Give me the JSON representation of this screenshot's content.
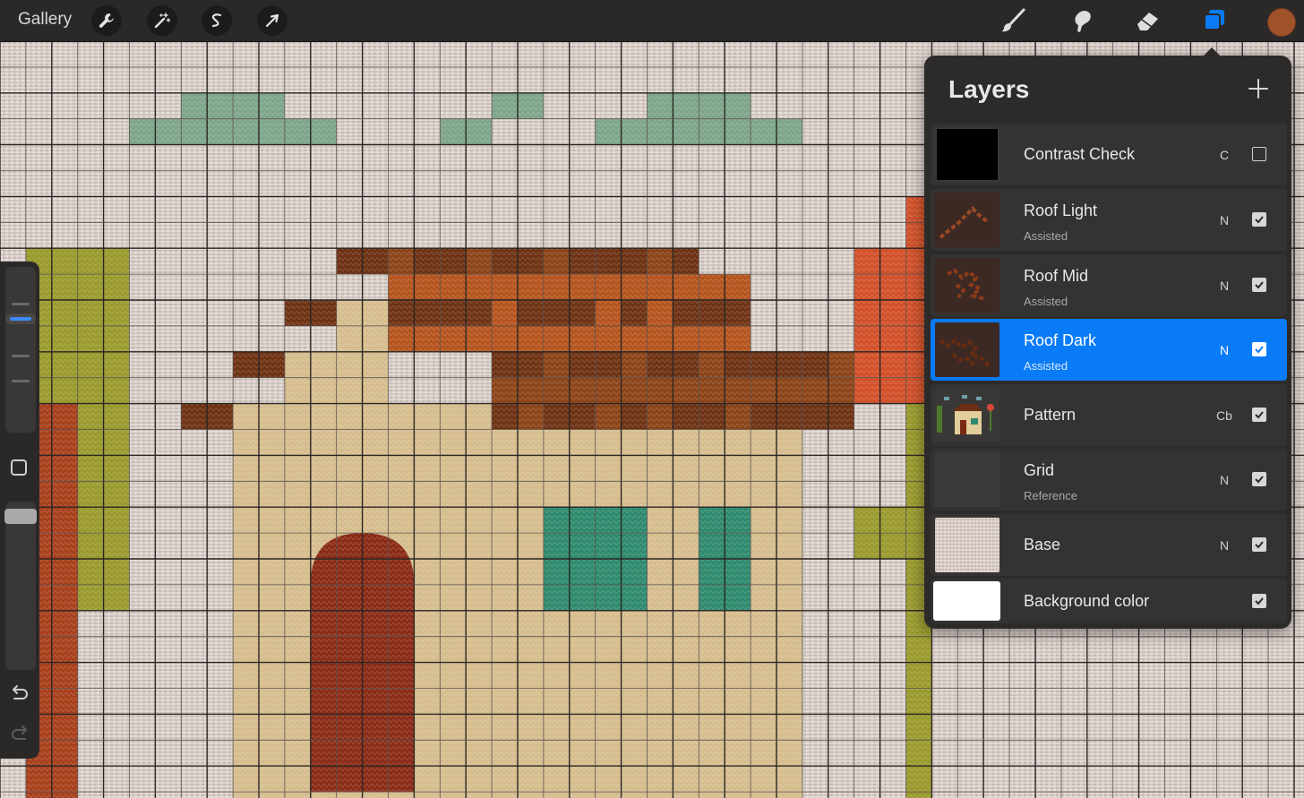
{
  "app": {
    "gallery_label": "Gallery",
    "left_tools": [
      "wrench-icon",
      "magic-wand-icon",
      "selection-icon",
      "transform-arrow-icon"
    ],
    "right_tools": [
      "brush-icon",
      "smudge-icon",
      "eraser-icon",
      "layers-icon"
    ],
    "active_tool": "layers-icon",
    "current_color": "#a2522a",
    "accent_color": "#0a7bf6"
  },
  "sidebar": {
    "tools": [
      "brush-size-slider",
      "modify-button",
      "opacity-slider",
      "undo-icon",
      "redo-icon"
    ]
  },
  "layers_panel": {
    "title": "Layers",
    "add_icon": "plus-icon",
    "layers": [
      {
        "name": "Contrast Check",
        "sub": "",
        "blend": "C",
        "visible": false,
        "selected": false
      },
      {
        "name": "Roof Light",
        "sub": "Assisted",
        "blend": "N",
        "visible": true,
        "selected": false
      },
      {
        "name": "Roof Mid",
        "sub": "Assisted",
        "blend": "N",
        "visible": true,
        "selected": false
      },
      {
        "name": "Roof Dark",
        "sub": "Assisted",
        "blend": "N",
        "visible": true,
        "selected": true
      },
      {
        "name": "Pattern",
        "sub": "",
        "blend": "Cb",
        "visible": true,
        "selected": false
      },
      {
        "name": "Grid",
        "sub": "Reference",
        "blend": "N",
        "visible": true,
        "selected": false
      },
      {
        "name": "Base",
        "sub": "",
        "blend": "N",
        "visible": true,
        "selected": false
      },
      {
        "name": "Background color",
        "sub": "",
        "blend": "",
        "visible": true,
        "selected": false
      }
    ]
  },
  "palette": {
    "linen": "#d6cbc4",
    "leaf_green": "#7fa58a",
    "roof_dark": "#6e3214",
    "roof_mid": "#8c4418",
    "roof_orange": "#b5541e",
    "wall": "#d6bd8e",
    "door": "#8a2c16",
    "window": "#2f8a6e",
    "olive": "#9a9a2e",
    "rust": "#a8401c",
    "red_orange": "#d2512a"
  }
}
